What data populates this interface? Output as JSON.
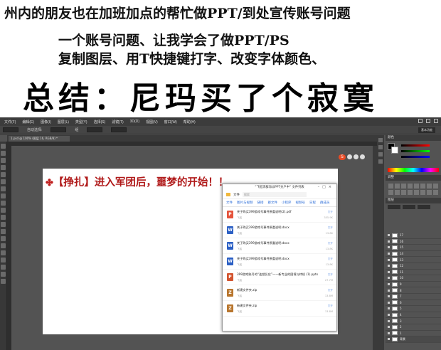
{
  "caption": {
    "line1": "州内的朋友也在加班加点的帮忙做PPT/到处宣传账号问题",
    "line2": "一个账号问题、让我学会了做PPT/PS",
    "line3": "复制图层、用T快捷键打字、改变字体颜色、",
    "line4": "总结：尼玛买了个寂寞"
  },
  "ps": {
    "menus": [
      "文件(F)",
      "编辑(E)",
      "图像(I)",
      "图层(L)",
      "类型(Y)",
      "选择(S)",
      "滤镜(T)",
      "3D(D)",
      "视图(V)",
      "窗口(W)",
      "帮助(H)"
    ],
    "options": [
      "自动选择:",
      "组"
    ],
    "workspace": "基本功能",
    "doc_tab": "1.psd @ 100% (图层 16, RGB/8) *",
    "canvas_title": "【挣扎】进入军团后，噩梦的开始！！",
    "ime_label": "S"
  },
  "dialog": {
    "title": "“飞船消群海派PPT分户中” 文件列表",
    "search_label": "文件",
    "search_placeholder": "搜索",
    "tabs": [
      "文件",
      "图片与视频",
      "链接",
      "群文件",
      "小程序",
      "视频号",
      "日程",
      "群成员"
    ],
    "files": [
      {
        "type": "pdf",
        "name": "关于购买399游戏号事件原委说明(2).pdf",
        "sub": "飞船",
        "act": "打开",
        "size": "355.9K"
      },
      {
        "type": "doc",
        "name": "关于购买399游戏号事件原委说明.docx",
        "sub": "飞船",
        "act": "打开",
        "size": "13.8K"
      },
      {
        "type": "doc",
        "name": "关于购买399游戏号事件原委说明.docx",
        "sub": "飞船",
        "act": "打开",
        "size": "13.8K"
      },
      {
        "type": "doc",
        "name": "关于购买399游戏号事件原委说明.docx",
        "sub": "飞船",
        "act": "打开",
        "size": "13.8K"
      },
      {
        "type": "ppt",
        "name": "399游戏账号的“连锁反应”——新专业的困境与转机 (1).pptx",
        "sub": "飞船",
        "act": "打开",
        "size": "27.7M"
      },
      {
        "type": "zip",
        "name": "新建文件夹.zip",
        "sub": "飞船",
        "act": "打开",
        "size": "13.8M"
      },
      {
        "type": "zip",
        "name": "新建文件夹.zip",
        "sub": "飞船",
        "act": "打开",
        "size": "13.8M"
      }
    ]
  },
  "panels": {
    "color_head": "颜色",
    "adjust_head": "调整",
    "layers_head": "图层",
    "layers": [
      "17",
      "16",
      "15",
      "14",
      "13",
      "12",
      "11",
      "10",
      "9",
      "8",
      "7",
      "6",
      "5",
      "4",
      "3",
      "2",
      "1",
      "背景"
    ]
  },
  "colors": {
    "title_red": "#b01a1a",
    "ps_dark": "#535353",
    "link_blue": "#2f6fd8"
  }
}
